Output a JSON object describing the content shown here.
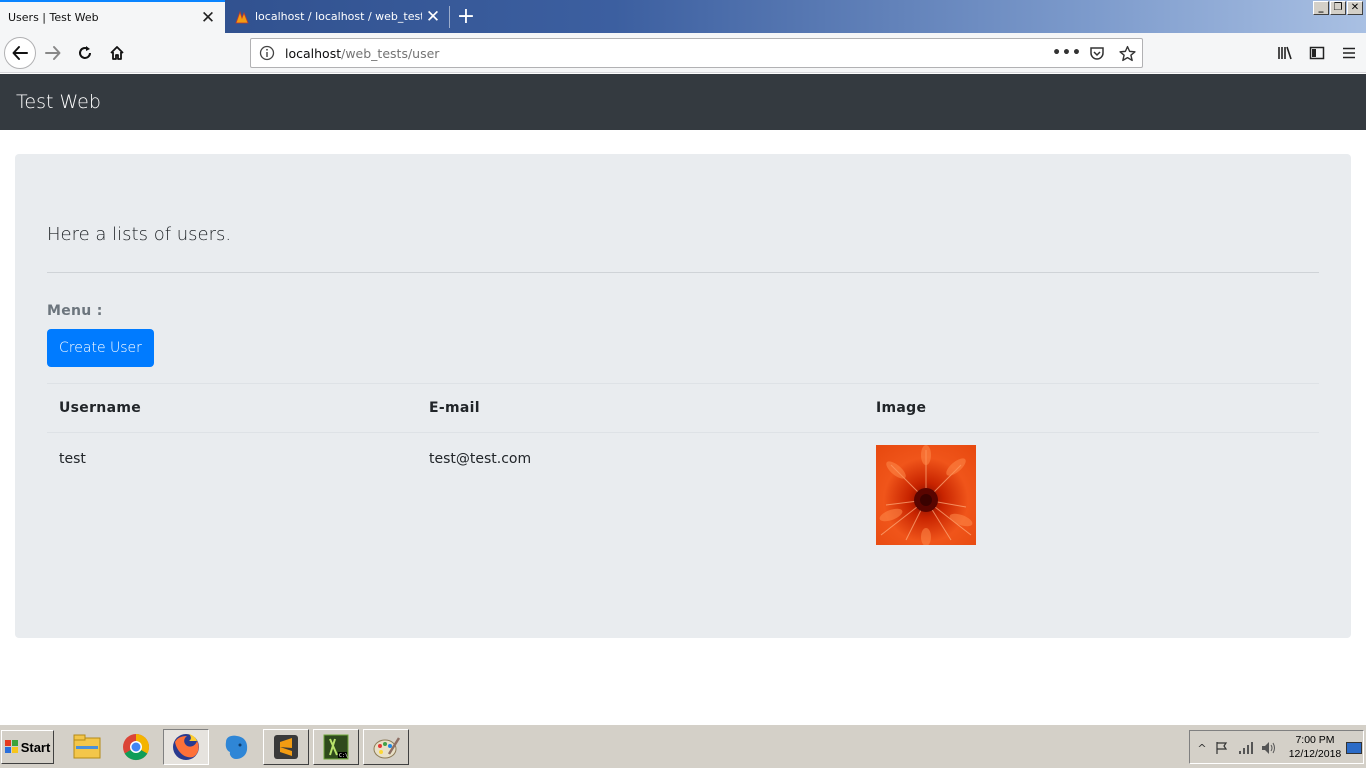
{
  "browser": {
    "tabs": [
      {
        "title": "Users | Test Web",
        "active": true
      },
      {
        "title": "localhost / localhost / web_tests |",
        "active": false
      }
    ],
    "url": {
      "host": "localhost",
      "path": "/web_tests/user"
    },
    "icons": {
      "back": "arrow-left-icon",
      "forward": "arrow-right-icon",
      "reload": "reload-icon",
      "home": "home-icon",
      "info": "info-icon",
      "page_actions": "ellipsis-icon",
      "pocket": "pocket-icon",
      "bookmark": "star-icon",
      "library": "library-icon",
      "sidebar": "sidebar-icon",
      "menu": "hamburger-icon"
    }
  },
  "site": {
    "brand": "Test Web",
    "lead": "Here a lists of users.",
    "menu_label": "Menu :",
    "create_button": "Create User",
    "table": {
      "headers": [
        "Username",
        "E-mail",
        "Image"
      ],
      "rows": [
        {
          "username": "test",
          "email": "test@test.com",
          "image": "flower-thumbnail"
        }
      ]
    },
    "colors": {
      "navbar": "#343a40",
      "jumbotron": "#e9ecef",
      "primary": "#007bff"
    }
  },
  "taskbar": {
    "start_label": "Start",
    "apps": [
      "file-explorer-icon",
      "chrome-icon",
      "firefox-icon",
      "evernote-icon",
      "sublime-text-icon",
      "terminal-icon",
      "paint-icon"
    ],
    "clock": {
      "time": "7:00 PM",
      "date": "12/12/2018"
    }
  }
}
